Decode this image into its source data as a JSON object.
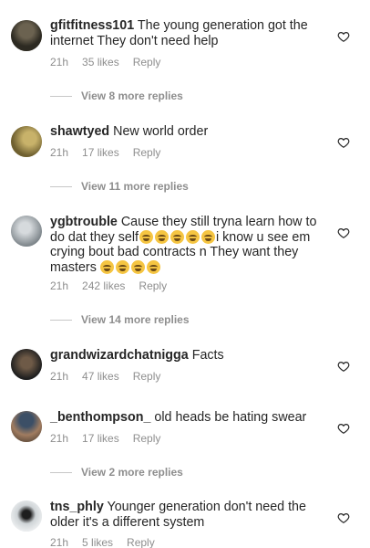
{
  "comments": [
    {
      "username": "gfitfitness101",
      "text": " The young generation got the internet They don't need help",
      "time": "21h",
      "likes": "35 likes",
      "reply": "Reply",
      "view_replies": "View 8 more replies",
      "avatar_color": "#3a3528"
    },
    {
      "username": "shawtyed",
      "text": " New world order",
      "time": "21h",
      "likes": "17 likes",
      "reply": "Reply",
      "view_replies": "View 11 more replies",
      "avatar_color": "#8d7a3c"
    },
    {
      "username": "ygbtrouble",
      "text_part1": " Cause they still tryna learn how to do dat they self",
      "text_part2": "i know u see em crying bout bad contracts n They want they masters",
      "time": "21h",
      "likes": "242 likes",
      "reply": "Reply",
      "view_replies": "View 14 more replies",
      "avatar_color": "#9aa1a6"
    },
    {
      "username": "grandwizardchatnigga",
      "text": " Facts",
      "time": "21h",
      "likes": "47 likes",
      "reply": "Reply",
      "avatar_color": "#2f2f2f"
    },
    {
      "username": "_benthompson_",
      "text": " old heads be hating swear",
      "time": "21h",
      "likes": "17 likes",
      "reply": "Reply",
      "view_replies": "View 2 more replies",
      "avatar_color": "#7c6450"
    },
    {
      "username": "tns_phly",
      "text": " Younger generation don't need the older it's a different system",
      "time": "21h",
      "likes": "5 likes",
      "reply": "Reply",
      "avatar_color": "#d9dde0"
    }
  ],
  "icons": {
    "heart": "heart-outline-icon",
    "emoji": "loudly-crying-face-emoji"
  }
}
